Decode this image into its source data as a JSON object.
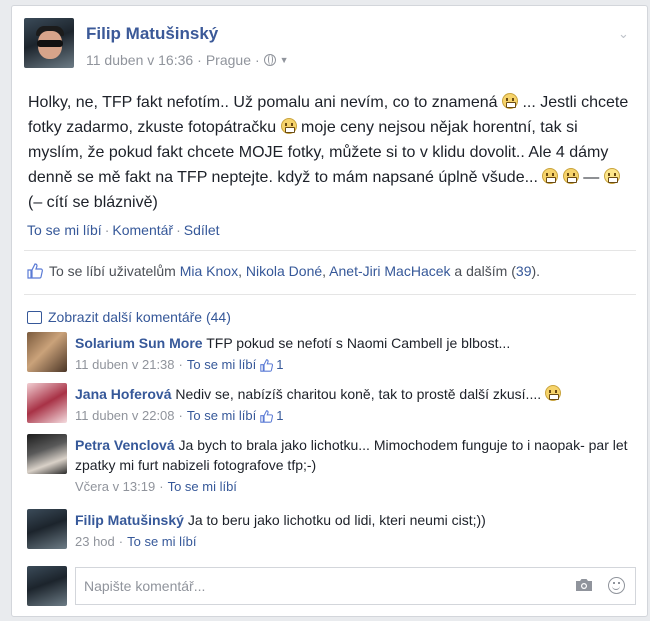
{
  "post": {
    "author": "Filip Matušinský",
    "date": "11 duben v 16:36",
    "location": "Prague",
    "dot": "·",
    "text_1": "Holky, ne, TFP fakt nefotím.. Už pomalu ani nevím, co to znamená",
    "text_2": "... Jestli chcete fotky zadarmo, zkuste fotopátračku",
    "text_3": "moje ceny nejsou nějak horentní, tak si myslím, že pokud fakt chcete MOJE fotky, můžete si to v klidu dovolit.. Ale 4 dámy denně se mě fakt na TFP neptejte. když to mám napsané úplně všude...",
    "text_4": "—",
    "feeling": "(– cítí se bláznivě)"
  },
  "actions": {
    "like": "To se mi líbí",
    "comment": "Komentář",
    "share": "Sdílet",
    "sep": "·"
  },
  "likes": {
    "prefix": "To se líbí uživatelům",
    "user1": "Mia Knox",
    "user2": "Nikola Doné",
    "user3": "Anet-Jiri MacHacek",
    "suffix_and": "a dalším",
    "count": "39",
    "comma": ",",
    "paren_open": "(",
    "paren_close": ")."
  },
  "more_comments": "Zobrazit další komentáře (44)",
  "comments": [
    {
      "name": "Solarium Sun More",
      "text": "TFP pokud se nefotí s Naomi Cambell je blbost...",
      "time": "11 duben v 21:38",
      "like": "To se mi líbí",
      "likes": "1"
    },
    {
      "name": "Jana Hoferová",
      "text": "Nediv se, nabízíš charitou koně, tak to prostě další zkusí....",
      "time": "11 duben v 22:08",
      "like": "To se mi líbí",
      "likes": "1"
    },
    {
      "name": "Petra Venclová",
      "text": "Ja bych to brala jako lichotku... Mimochodem funguje to i naopak- par let zpatky mi furt nabizeli fotografove tfp;-)",
      "time": "Včera v 13:19",
      "like": "To se mi líbí"
    },
    {
      "name": "Filip Matušinský",
      "text": "Ja to beru jako lichotku od lidi, kteri neumi cist;))",
      "time": "23 hod",
      "like": "To se mi líbí"
    }
  ],
  "comment_input": {
    "placeholder": "Napište komentář..."
  },
  "colors": {
    "link": "#365899",
    "name": "#3b5998",
    "meta": "#90949c",
    "background": "#e9ebee"
  }
}
